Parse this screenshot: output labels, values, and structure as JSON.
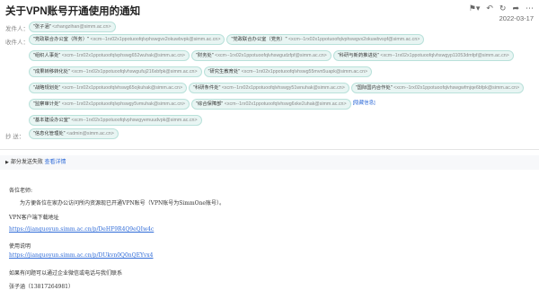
{
  "header": {
    "title": "关于VPN账号开通使用的通知",
    "date": "2022-03-17"
  },
  "toolbar": {
    "flag_icon": "flag-icon",
    "reply_icon": "reply-icon",
    "refresh_icon": "refresh-icon",
    "forward_icon": "forward-icon",
    "more_icon": "more-icon"
  },
  "sender": {
    "label": "发件人：",
    "name": "\"张子涵\"",
    "email": "<zhangzihan@simm.ac.cn>"
  },
  "recipients": {
    "label": "收件人：",
    "items": [
      {
        "name": "\"党政联合办公室（所务）\"",
        "email": "<xcm--1rx02x1ppotuoofqlvphswgvx2okuwbvpk@simm.ac.cn>"
      },
      {
        "name": "\"党政联合办公室（党务）\"",
        "email": "<xcm--1rx02x1ppotuoofqlvphswgvx2okuwbvspf@simm.ac.cn>"
      },
      {
        "name": "\"组织人事处\"",
        "email": "<xcm--1rx02x1ppotuoofqlvphswg652wuhak@simm.ac.cn>"
      },
      {
        "name": "\"财务处\"",
        "email": "<xcm--1rx02x1ppotuoofqlvhswgudzfpf@simm.ac.cn>"
      },
      {
        "name": "\"科研与新药推进处\"",
        "email": "<xcm--1rx02x1ppotuoofqlvhswgyp11053dmfpf@simm.ac.cn>"
      },
      {
        "name": "\"成果转移转化处\"",
        "email": "<xcm--1rx02x1ppotuoofqlvhswgufuj216xbfpk@simm.ac.cn>"
      },
      {
        "name": "\"研究生教育处\"",
        "email": "<xcm--1rx02x1ppotuoofqlvhswg55mvn5uapk@simm.ac.cn>"
      },
      {
        "name": "\"战略规划处\"",
        "email": "<xcm--1rx02x1ppotuoofqlvhswg65ojkuhak@simm.ac.cn>"
      },
      {
        "name": "\"科研条件处\"",
        "email": "<xcm--1rx02x1ppotuoofqlvhswgy51wnuhak@simm.ac.cn>"
      },
      {
        "name": "\"国际国内合作处\"",
        "email": "<xcm--1rx02x1ppotuoofqlvhswgwfmjqe6bfpk@simm.ac.cn>"
      },
      {
        "name": "\"监察审计处\"",
        "email": "<xcm--1rx02x1ppotuoofqlvphswgy5vmuhak@simm.ac.cn>"
      },
      {
        "name": "\"综合保障部\"",
        "email": "<xcm--1rx02x1ppotuoofqlvhswg6xke2uhak@simm.ac.cn>"
      },
      {
        "name": "\"基本建设办公室\"",
        "email": "<xcm--1rx02x1ppotuoofqlvphswgyemuudvpk@simm.ac.cn>"
      }
    ],
    "hide_link": "[隐藏信息]"
  },
  "cc": {
    "label": "抄  送：",
    "items": [
      {
        "name": "\"信息化管理处\"",
        "email": "<admin@simm.ac.cn>"
      }
    ]
  },
  "fail_notice": {
    "text": "部分发送失败",
    "link": "查看详情"
  },
  "body": {
    "greeting": "各位老师:",
    "paragraph": "为方便各位在家办公访问所内资源现已开通VPN账号（VPN账号为SimmOne账号）。",
    "vpn_label": "VPN客户端下载地址",
    "vpn_link": "https://jianguoyun.simm.ac.cn/p/DeHF9R4Q9eQIw4c",
    "manual_label": "使用说明",
    "manual_link": "https://jianguoyun.simm.ac.cn/p/DUkvn0Q0nQEYvx4",
    "contact": "如果有问题可以通过企业微信或电话与我们联系",
    "signature": "张子涵（13817264981）"
  }
}
